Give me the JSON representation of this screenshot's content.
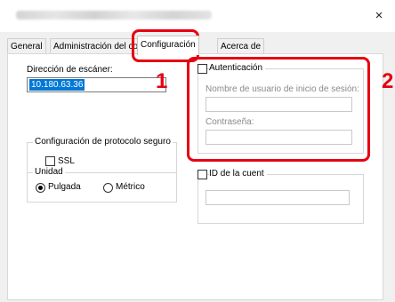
{
  "window": {
    "title": "Propiedades: Kyocera TASKalfa (Red: Scan Network)",
    "close_glyph": "×"
  },
  "tabs": [
    {
      "label": "General"
    },
    {
      "label": "Administración del colo"
    },
    {
      "label": "Configuración"
    },
    {
      "label": "Acerca de"
    }
  ],
  "scanner": {
    "label": "Dirección de escáner:",
    "value": "10.180.63.36"
  },
  "secure": {
    "title": "Configuración de protocolo seguro",
    "ssl_label": "SSL",
    "ssl_checked": false
  },
  "unit": {
    "title": "Unidad",
    "options": [
      {
        "label": "Pulgada",
        "selected": true
      },
      {
        "label": "Métrico",
        "selected": false
      }
    ]
  },
  "auth": {
    "label": "Autenticación",
    "checked": false,
    "username_label": "Nombre de usuario de inicio de sesión:",
    "username_value": "",
    "password_label": "Contraseña:",
    "password_value": ""
  },
  "account": {
    "label": "ID de la cuent",
    "checked": false,
    "value": ""
  },
  "callouts": {
    "one": "1",
    "two": "2",
    "color": "#e60012"
  }
}
